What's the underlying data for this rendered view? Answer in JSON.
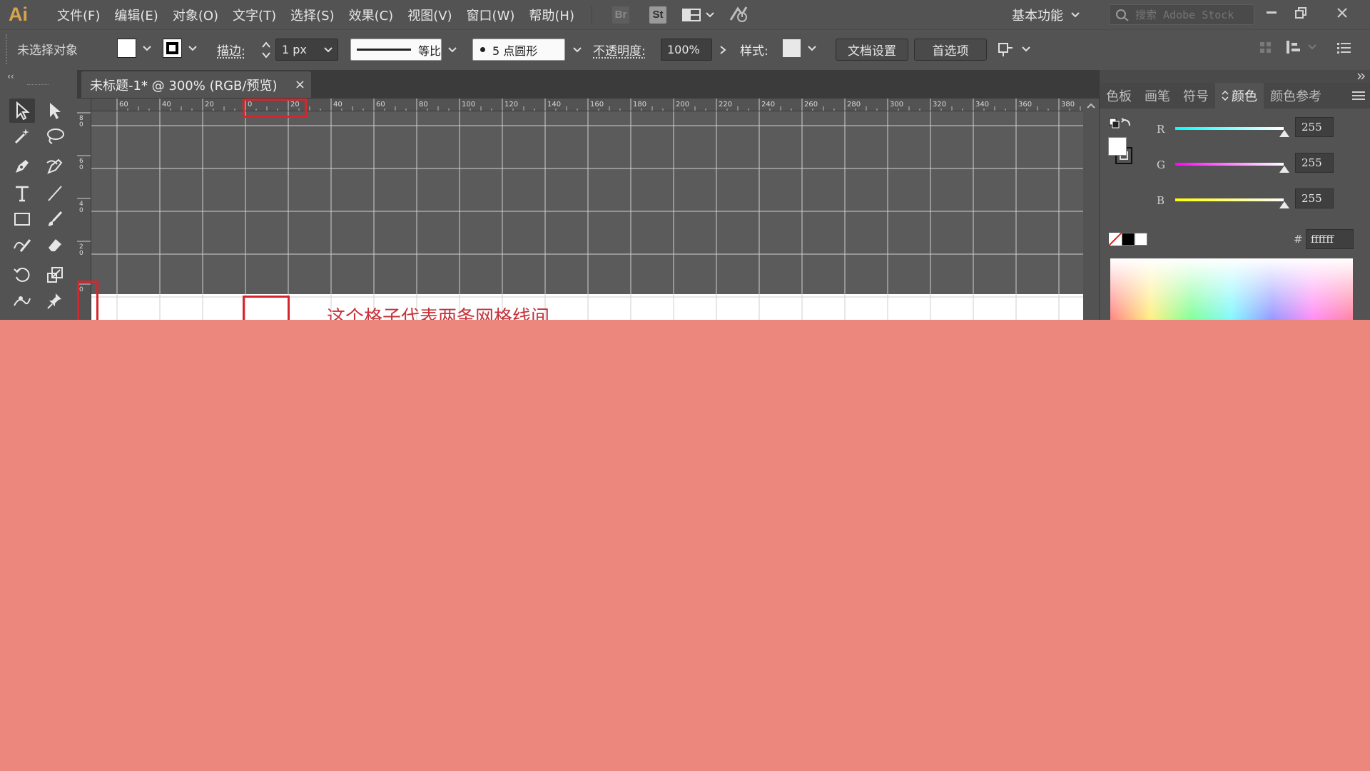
{
  "app": {
    "logo": "Ai"
  },
  "menu": [
    "文件(F)",
    "编辑(E)",
    "对象(O)",
    "文字(T)",
    "选择(S)",
    "效果(C)",
    "视图(V)",
    "窗口(W)",
    "帮助(H)"
  ],
  "badges": {
    "bridge": "Br",
    "stock": "St"
  },
  "workspace": {
    "label": "基本功能"
  },
  "search": {
    "placeholder": "搜索 Adobe Stock"
  },
  "control": {
    "selection_status": "未选择对象",
    "stroke_label": "描边:",
    "stroke_width": "1 px",
    "stroke_profile": "等比",
    "brush": "5 点圆形",
    "opacity_label": "不透明度:",
    "opacity_value": "100%",
    "style_label": "样式:",
    "doc_setup_button": "文档设置",
    "preferences_button": "首选项"
  },
  "document": {
    "tab_title": "未标题-1* @ 300% (RGB/预览)",
    "close_glyph": "×"
  },
  "rulers": {
    "h_ticks": [
      "60",
      "40",
      "20",
      "0",
      "20",
      "40",
      "60",
      "80",
      "100",
      "120",
      "140",
      "160",
      "180",
      "200",
      "220",
      "240",
      "260",
      "280",
      "300",
      "320",
      "340",
      "360",
      "380"
    ],
    "v_ticks": [
      "8\n0",
      "6\n0",
      "4\n0",
      "2\n0",
      "0"
    ]
  },
  "panel": {
    "tabs": [
      "色板",
      "画笔",
      "符号",
      "颜色",
      "颜色参考"
    ],
    "active_tab": "颜色",
    "r_label": "R",
    "r_value": "255",
    "g_label": "G",
    "g_value": "255",
    "b_label": "B",
    "b_value": "255",
    "hex_symbol": "#",
    "hex_value": "ffffff"
  },
  "annotation": {
    "text": "这个格子代表两条网格线间"
  },
  "colors": {
    "accent_red": "#d6262d",
    "overlay": "#eb877c",
    "chrome": "#535353"
  }
}
